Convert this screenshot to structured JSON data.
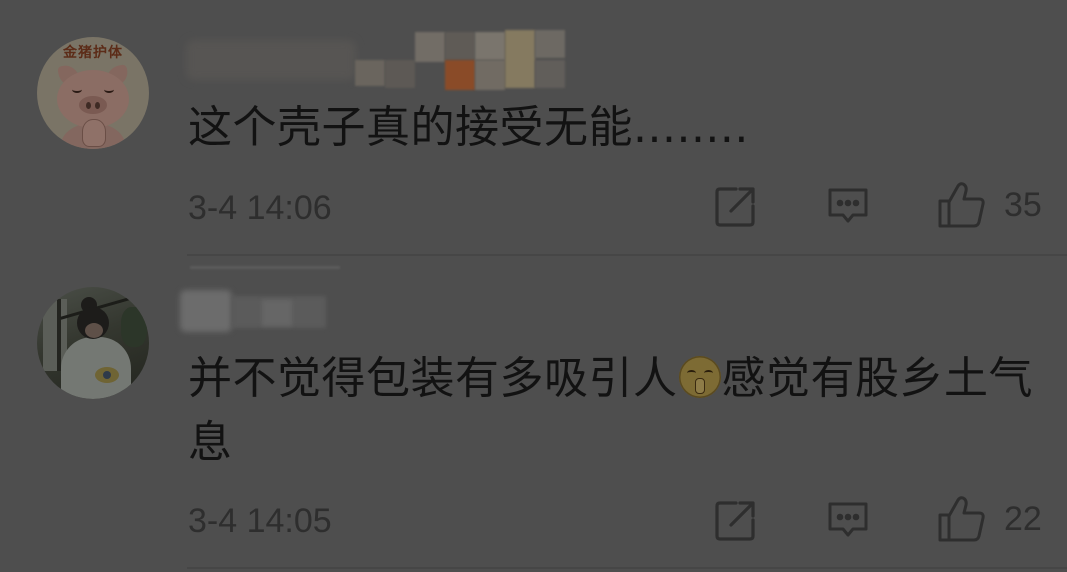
{
  "colors": {
    "background": "#4e4e4e",
    "text": "#121212",
    "meta": "#2e2e2e",
    "divider": "#464646"
  },
  "icons": {
    "share": "share-icon",
    "comment": "comment-icon",
    "like": "thumbs-up-icon"
  },
  "comments": [
    {
      "avatar_text": "金猪护体",
      "content": "这个壳子真的接受无能........",
      "time": "3-4 14:06",
      "like_count": "35"
    },
    {
      "content_before_emoji": "并不觉得包装有多吸引人",
      "emoji": "shush-face",
      "content_after_emoji": "感觉有股乡土气息",
      "time": "3-4 14:05",
      "like_count": "22"
    }
  ]
}
